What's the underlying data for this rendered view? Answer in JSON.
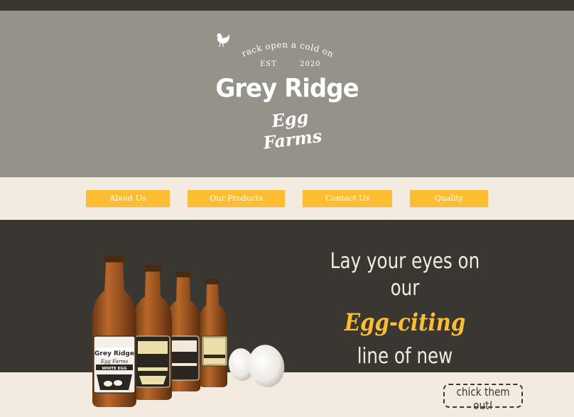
{
  "logo": {
    "tagline": "Crack open a cold one",
    "est_label": "EST",
    "est_year": "2020",
    "brand": "Grey Ridge",
    "sub_brand": "Egg Farms"
  },
  "nav": {
    "items": [
      {
        "label": "About Us"
      },
      {
        "label": "Our Products"
      },
      {
        "label": "Contact Us"
      },
      {
        "label": "Quality"
      }
    ]
  },
  "promo": {
    "line1": "Lay your eyes on our",
    "line2": "Egg-citing",
    "line3": "line of new products",
    "cta": "chick them out!"
  },
  "bottle_labels": {
    "brand": "Grey Ridge",
    "sub": "Egg Farms",
    "variant": "WHITE EGG"
  },
  "colors": {
    "dark": "#3a3733",
    "hero_grey": "#95928a",
    "cream": "#f3ebdf",
    "accent": "#fdbd32"
  }
}
